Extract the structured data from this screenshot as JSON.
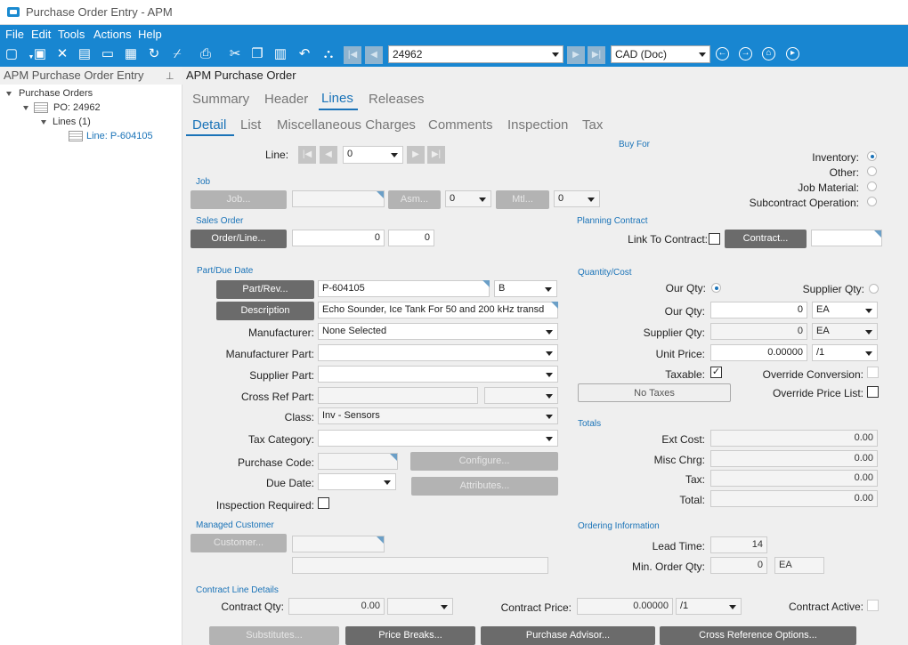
{
  "window": {
    "title": "Purchase Order Entry - APM"
  },
  "menu": [
    "File",
    "Edit",
    "Tools",
    "Actions",
    "Help"
  ],
  "toolbar": {
    "po_value": "24962",
    "currency": "CAD (Doc)"
  },
  "tree": {
    "header": "APM Purchase Order Entry",
    "root": "Purchase Orders",
    "po": "PO: 24962",
    "lines": "Lines (1)",
    "line": "Line: P-604105"
  },
  "main": {
    "title": "APM Purchase Order",
    "tabs": [
      "Summary",
      "Header",
      "Lines",
      "Releases"
    ],
    "subtabs": [
      "Detail",
      "List",
      "Miscellaneous Charges",
      "Comments",
      "Inspection",
      "Tax"
    ]
  },
  "line_nav": {
    "label": "Line:",
    "value": "0"
  },
  "buy_for": {
    "title": "Buy For",
    "options": [
      "Inventory:",
      "Other:",
      "Job Material:",
      "Subcontract Operation:"
    ],
    "selected": "Inventory:"
  },
  "job": {
    "title": "Job",
    "job_btn": "Job...",
    "asm_btn": "Asm...",
    "asm_value": "0",
    "mtl_btn": "Mtl...",
    "mtl_value": "0"
  },
  "sales_order": {
    "title": "Sales Order",
    "btn": "Order/Line...",
    "order": "0",
    "line": "0"
  },
  "planning": {
    "title": "Planning Contract",
    "link_label": "Link To Contract:",
    "btn": "Contract..."
  },
  "part": {
    "title": "Part/Due Date",
    "partrev_btn": "Part/Rev...",
    "part_value": "P-604105",
    "rev_value": "B",
    "desc_btn": "Description",
    "desc_value": "Echo Sounder, Ice Tank For 50 and 200 kHz transd",
    "manufacturer_label": "Manufacturer:",
    "manufacturer_value": "None Selected",
    "mfg_part_label": "Manufacturer Part:",
    "supplier_part_label": "Supplier Part:",
    "crossref_label": "Cross Ref Part:",
    "class_label": "Class:",
    "class_value": "Inv - Sensors",
    "taxcat_label": "Tax Category:",
    "purchcode_label": "Purchase Code:",
    "configure_btn": "Configure...",
    "duedate_label": "Due Date:",
    "attributes_btn": "Attributes...",
    "inspection_label": "Inspection Required:"
  },
  "managed_customer": {
    "title": "Managed Customer",
    "btn": "Customer..."
  },
  "qty_cost": {
    "title": "Quantity/Cost",
    "our_qty_radio": "Our Qty:",
    "supplier_qty_radio": "Supplier Qty:",
    "our_qty_label": "Our Qty:",
    "our_qty": "0",
    "our_uom": "EA",
    "supplier_qty_label": "Supplier Qty:",
    "supplier_qty": "0",
    "supplier_uom": "EA",
    "unit_price_label": "Unit Price:",
    "unit_price": "0.00000",
    "price_per": "/1",
    "taxable_label": "Taxable:",
    "override_conv_label": "Override Conversion:",
    "no_taxes_btn": "No Taxes",
    "override_price_label": "Override Price List:"
  },
  "totals": {
    "title": "Totals",
    "ext_cost_label": "Ext Cost:",
    "ext_cost": "0.00",
    "misc_label": "Misc Chrg:",
    "misc": "0.00",
    "tax_label": "Tax:",
    "tax": "0.00",
    "total_label": "Total:",
    "total": "0.00"
  },
  "ordering": {
    "title": "Ordering Information",
    "lead_label": "Lead Time:",
    "lead": "14",
    "min_label": "Min. Order Qty:",
    "min": "0",
    "min_uom": "EA"
  },
  "contract_details": {
    "title": "Contract Line Details",
    "qty_label": "Contract Qty:",
    "qty": "0.00",
    "price_label": "Contract Price:",
    "price": "0.00000",
    "per": "/1",
    "active_label": "Contract Active:"
  },
  "bottom_buttons": [
    "Substitutes...",
    "Price Breaks...",
    "Purchase Advisor...",
    "Cross Reference Options..."
  ]
}
